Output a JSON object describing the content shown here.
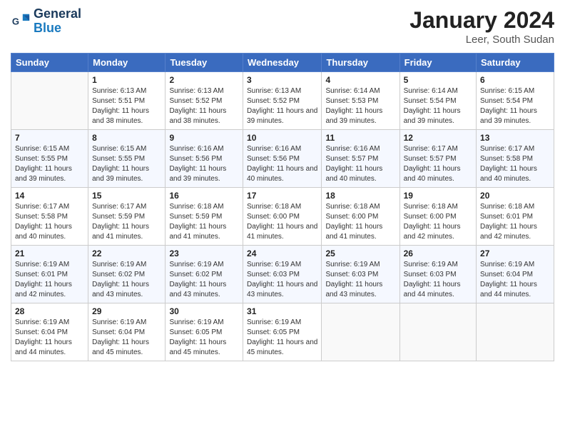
{
  "header": {
    "logo_general": "General",
    "logo_blue": "Blue",
    "month_year": "January 2024",
    "location": "Leer, South Sudan"
  },
  "days_of_week": [
    "Sunday",
    "Monday",
    "Tuesday",
    "Wednesday",
    "Thursday",
    "Friday",
    "Saturday"
  ],
  "weeks": [
    [
      {
        "day": "",
        "info": ""
      },
      {
        "day": "1",
        "info": "Sunrise: 6:13 AM\nSunset: 5:51 PM\nDaylight: 11 hours and 38 minutes."
      },
      {
        "day": "2",
        "info": "Sunrise: 6:13 AM\nSunset: 5:52 PM\nDaylight: 11 hours and 38 minutes."
      },
      {
        "day": "3",
        "info": "Sunrise: 6:13 AM\nSunset: 5:52 PM\nDaylight: 11 hours and 39 minutes."
      },
      {
        "day": "4",
        "info": "Sunrise: 6:14 AM\nSunset: 5:53 PM\nDaylight: 11 hours and 39 minutes."
      },
      {
        "day": "5",
        "info": "Sunrise: 6:14 AM\nSunset: 5:54 PM\nDaylight: 11 hours and 39 minutes."
      },
      {
        "day": "6",
        "info": "Sunrise: 6:15 AM\nSunset: 5:54 PM\nDaylight: 11 hours and 39 minutes."
      }
    ],
    [
      {
        "day": "7",
        "info": "Sunrise: 6:15 AM\nSunset: 5:55 PM\nDaylight: 11 hours and 39 minutes."
      },
      {
        "day": "8",
        "info": "Sunrise: 6:15 AM\nSunset: 5:55 PM\nDaylight: 11 hours and 39 minutes."
      },
      {
        "day": "9",
        "info": "Sunrise: 6:16 AM\nSunset: 5:56 PM\nDaylight: 11 hours and 39 minutes."
      },
      {
        "day": "10",
        "info": "Sunrise: 6:16 AM\nSunset: 5:56 PM\nDaylight: 11 hours and 40 minutes."
      },
      {
        "day": "11",
        "info": "Sunrise: 6:16 AM\nSunset: 5:57 PM\nDaylight: 11 hours and 40 minutes."
      },
      {
        "day": "12",
        "info": "Sunrise: 6:17 AM\nSunset: 5:57 PM\nDaylight: 11 hours and 40 minutes."
      },
      {
        "day": "13",
        "info": "Sunrise: 6:17 AM\nSunset: 5:58 PM\nDaylight: 11 hours and 40 minutes."
      }
    ],
    [
      {
        "day": "14",
        "info": "Sunrise: 6:17 AM\nSunset: 5:58 PM\nDaylight: 11 hours and 40 minutes."
      },
      {
        "day": "15",
        "info": "Sunrise: 6:17 AM\nSunset: 5:59 PM\nDaylight: 11 hours and 41 minutes."
      },
      {
        "day": "16",
        "info": "Sunrise: 6:18 AM\nSunset: 5:59 PM\nDaylight: 11 hours and 41 minutes."
      },
      {
        "day": "17",
        "info": "Sunrise: 6:18 AM\nSunset: 6:00 PM\nDaylight: 11 hours and 41 minutes."
      },
      {
        "day": "18",
        "info": "Sunrise: 6:18 AM\nSunset: 6:00 PM\nDaylight: 11 hours and 41 minutes."
      },
      {
        "day": "19",
        "info": "Sunrise: 6:18 AM\nSunset: 6:00 PM\nDaylight: 11 hours and 42 minutes."
      },
      {
        "day": "20",
        "info": "Sunrise: 6:18 AM\nSunset: 6:01 PM\nDaylight: 11 hours and 42 minutes."
      }
    ],
    [
      {
        "day": "21",
        "info": "Sunrise: 6:19 AM\nSunset: 6:01 PM\nDaylight: 11 hours and 42 minutes."
      },
      {
        "day": "22",
        "info": "Sunrise: 6:19 AM\nSunset: 6:02 PM\nDaylight: 11 hours and 43 minutes."
      },
      {
        "day": "23",
        "info": "Sunrise: 6:19 AM\nSunset: 6:02 PM\nDaylight: 11 hours and 43 minutes."
      },
      {
        "day": "24",
        "info": "Sunrise: 6:19 AM\nSunset: 6:03 PM\nDaylight: 11 hours and 43 minutes."
      },
      {
        "day": "25",
        "info": "Sunrise: 6:19 AM\nSunset: 6:03 PM\nDaylight: 11 hours and 43 minutes."
      },
      {
        "day": "26",
        "info": "Sunrise: 6:19 AM\nSunset: 6:03 PM\nDaylight: 11 hours and 44 minutes."
      },
      {
        "day": "27",
        "info": "Sunrise: 6:19 AM\nSunset: 6:04 PM\nDaylight: 11 hours and 44 minutes."
      }
    ],
    [
      {
        "day": "28",
        "info": "Sunrise: 6:19 AM\nSunset: 6:04 PM\nDaylight: 11 hours and 44 minutes."
      },
      {
        "day": "29",
        "info": "Sunrise: 6:19 AM\nSunset: 6:04 PM\nDaylight: 11 hours and 45 minutes."
      },
      {
        "day": "30",
        "info": "Sunrise: 6:19 AM\nSunset: 6:05 PM\nDaylight: 11 hours and 45 minutes."
      },
      {
        "day": "31",
        "info": "Sunrise: 6:19 AM\nSunset: 6:05 PM\nDaylight: 11 hours and 45 minutes."
      },
      {
        "day": "",
        "info": ""
      },
      {
        "day": "",
        "info": ""
      },
      {
        "day": "",
        "info": ""
      }
    ]
  ]
}
